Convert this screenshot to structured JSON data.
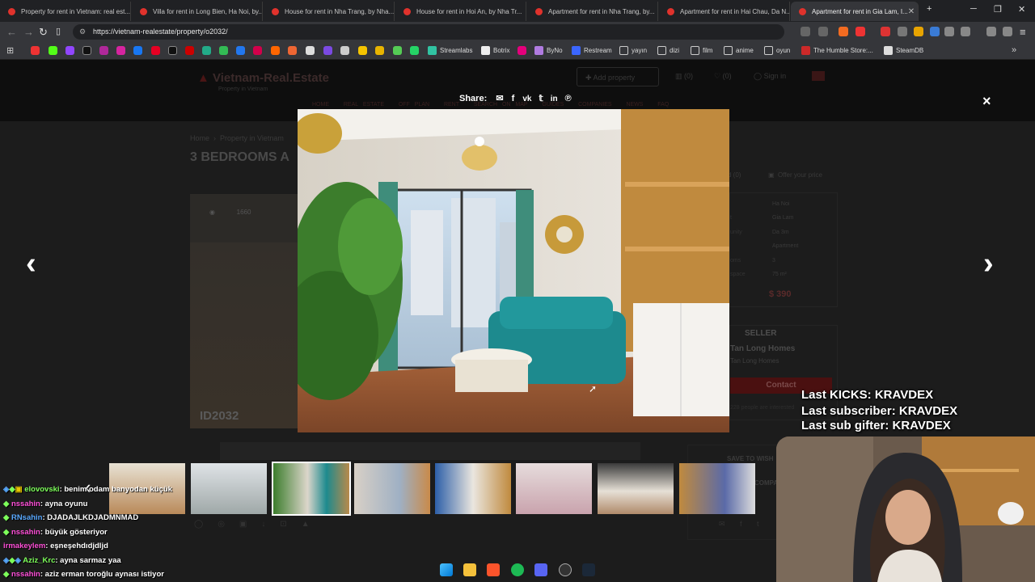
{
  "browser": {
    "tabs": [
      {
        "title": "Property for rent in Vietnam: real est..."
      },
      {
        "title": "Villa for rent in Long Bien, Ha Noi, by..."
      },
      {
        "title": "House for rent in Nha Trang, by Nha..."
      },
      {
        "title": "House for rent in Hoi An, by Nha Tr..."
      },
      {
        "title": "Apartment for rent in Nha Trang, by..."
      },
      {
        "title": "Apartment for rent in Hai Chau, Da N..."
      },
      {
        "title": "Apartment for rent in Gia Lam, I..."
      }
    ],
    "url": "https://vietnam-realestate/property/o2032/",
    "bookmarks": [
      "Streamlabs",
      "Botrix",
      "ByNo",
      "Restream",
      "yayın",
      "dizi",
      "film",
      "anime",
      "oyun",
      "The Humble Store:...",
      "SteamDB"
    ]
  },
  "site": {
    "logo": "Vietnam-Real.Estate",
    "tagline": "Property in Vietnam",
    "add_property": "Add property",
    "counts": [
      "(0)",
      "(0)"
    ],
    "sign_in": "Sign in",
    "nav": [
      "HOME",
      "REAL ESTATE",
      "OFF PLAN",
      "RENT",
      "SEARCH ON MAP",
      "GUIDES",
      "COMPANIES",
      "NEWS",
      "FAQ"
    ],
    "breadcrumb": [
      "Home",
      "Property in Vietnam"
    ],
    "title": "3 BEDROOMS A",
    "id_label": "ID2032",
    "views": "1660",
    "offer_price": "Offer your price",
    "details": [
      {
        "k": "",
        "v": "Ha Noi"
      },
      {
        "k": "t",
        "v": "Gia Lam"
      },
      {
        "k": "unity",
        "v": "Da 3m"
      },
      {
        "k": "",
        "v": "Apartment"
      },
      {
        "k": "oms",
        "v": "3"
      },
      {
        "k": "space",
        "v": "75 m²"
      }
    ],
    "price": "$ 390",
    "seller_title": "SELLER",
    "seller_name": "Tan Long Homes",
    "seller_sub": "Tan Long Homes",
    "contact": "Contact",
    "save_to_wishlist": "SAVE TO WISH",
    "compare": "COMPA"
  },
  "lightbox": {
    "share_label": "Share:",
    "share_icons": [
      "mail-icon",
      "facebook-icon",
      "vk-icon",
      "twitter-icon",
      "linkedin-icon",
      "pinterest-icon"
    ],
    "close": "×",
    "prev": "‹",
    "next": "›"
  },
  "stream_overlay": {
    "last_kicks": "Last KICKS: KRAVDEX",
    "last_subscriber": "Last subscriber: KRAVDEX",
    "last_sub_gifter": "Last sub gifter: KRAVDEX"
  },
  "chat": [
    {
      "user": "elovovski",
      "msg": ": benim odam banyodan küçük",
      "color": "#7dff5a"
    },
    {
      "user": "nssahin",
      "msg": ": ayna oyunu",
      "color": "#ff4fd8"
    },
    {
      "user": "RNsahin",
      "msg": ": DJADAJLKDJADMNMAD",
      "color": "#5aa9ff"
    },
    {
      "user": "nssahin",
      "msg": ": büyük gösteriyor",
      "color": "#ff4fd8"
    },
    {
      "user": "irmakeylem",
      "msg": ": eşneşehdıdjdljd",
      "color": "#ff4fd8"
    },
    {
      "user": "Aziz_Krc",
      "msg": ": ayna sarmaz yaa",
      "color": "#7dff5a"
    },
    {
      "user": "nssahin",
      "msg": ": aziz erman toroğlu aynası istiyor",
      "color": "#ff4fd8"
    }
  ],
  "colors": {
    "accent_red": "#c8161d",
    "brand_red": "#e0322c"
  }
}
